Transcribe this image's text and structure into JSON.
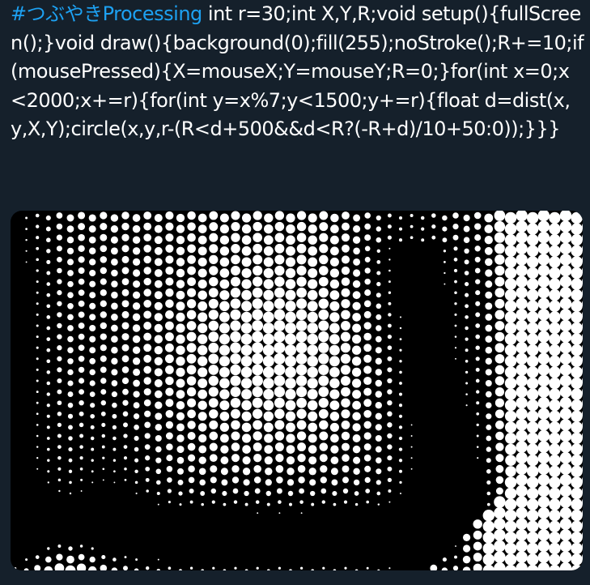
{
  "tweet": {
    "hashtag": "#つぶやきProcessing",
    "code_text": " int r=30;int X,Y,R;void setup(){fullScreen();}void draw(){background(0);fill(255);noStroke();R+=10;if(mousePressed){X=mouseX;Y=mouseY;R=0;}for(int x=0;x<2000;x+=r){for(int y=x%7;y<1500;y+=r){float d=dist(x,y,X,Y);circle(x,y,r-(R<d+500&&d<R?(-R+d)/10+50:0));}}}"
  },
  "colors": {
    "background": "#15202b",
    "hashtag": "#1da1f2",
    "text": "#ffffff",
    "dot": "#ffffff",
    "image_bg": "#000000"
  }
}
